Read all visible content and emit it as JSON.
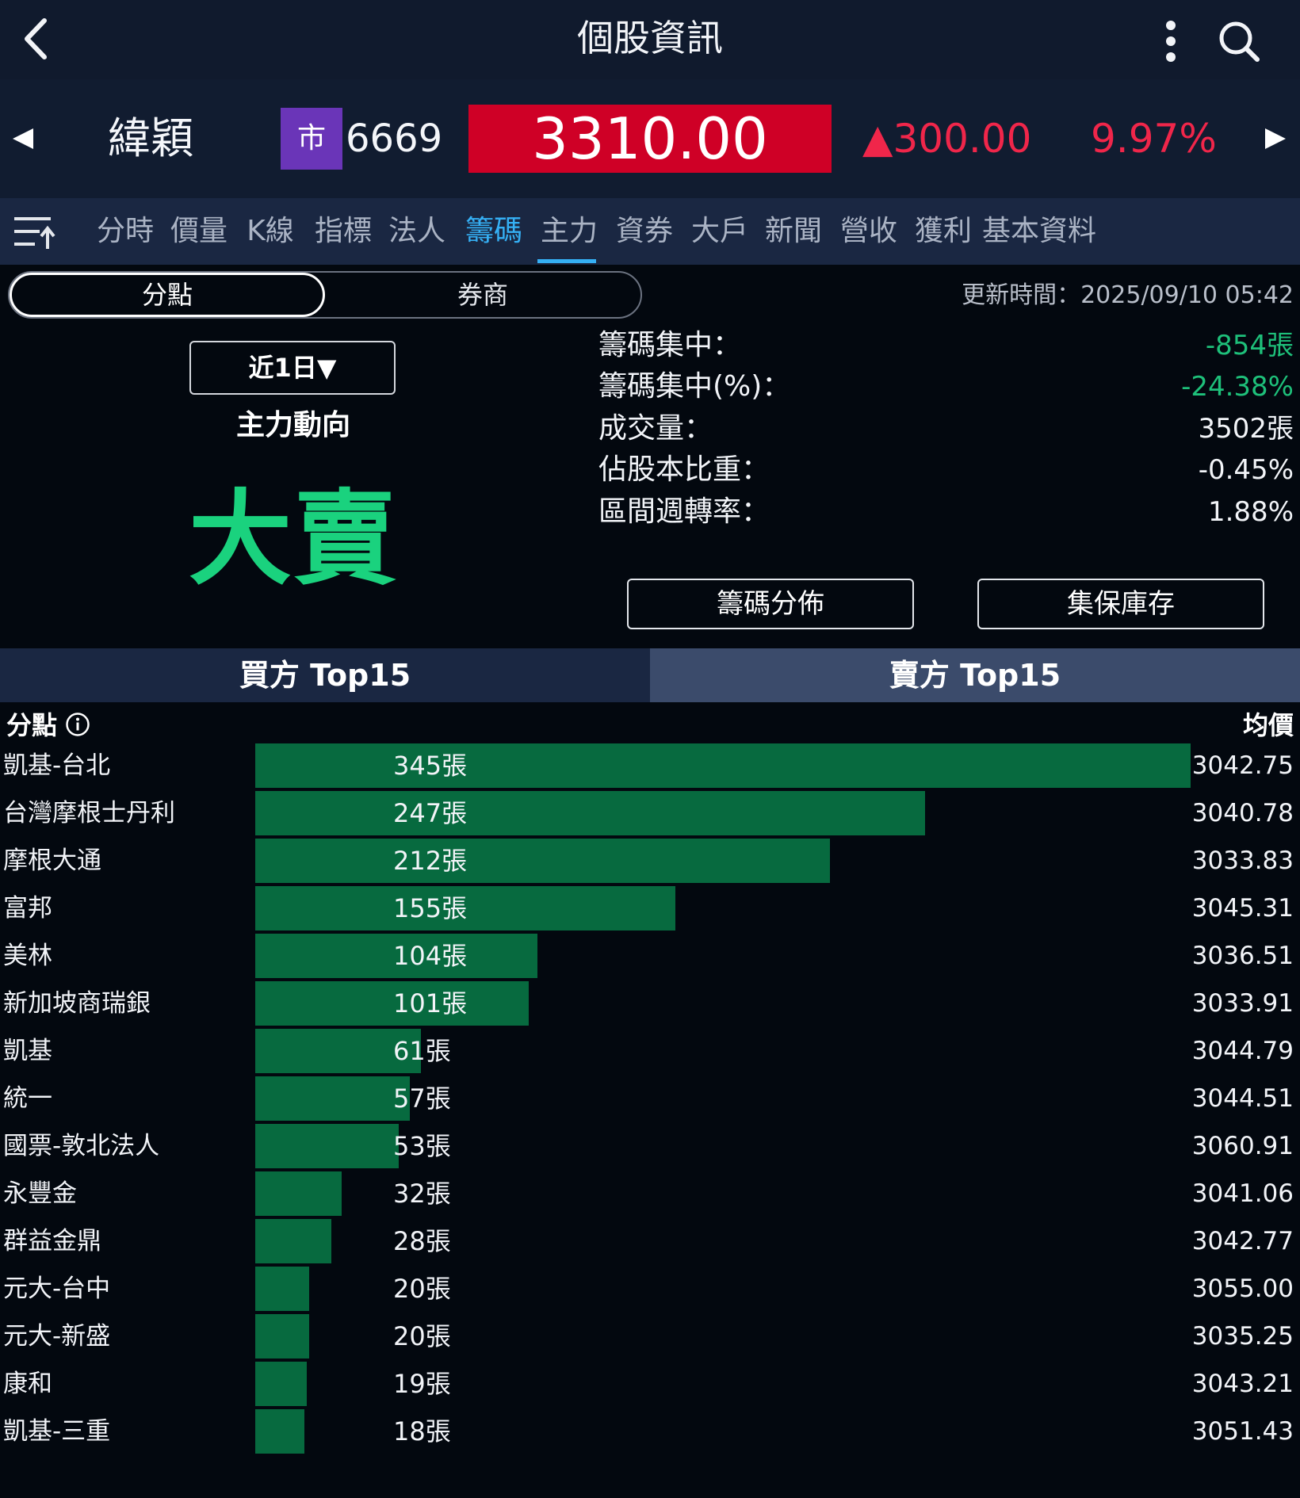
{
  "header": {
    "title": "個股資訊"
  },
  "quote": {
    "stock_name": "緯穎",
    "market_badge": "市",
    "stock_code": "6669",
    "price": "3310.00",
    "change": "▲300.00",
    "change_pct": "9.97%"
  },
  "tabs": [
    {
      "label": "分時",
      "active": false
    },
    {
      "label": "價量",
      "active": false
    },
    {
      "label": "K線",
      "active": false
    },
    {
      "label": "指標",
      "active": false
    },
    {
      "label": "法人",
      "active": false
    },
    {
      "label": "籌碼",
      "active": true
    },
    {
      "label": "主力",
      "active": false
    },
    {
      "label": "資券",
      "active": false
    },
    {
      "label": "大戶",
      "active": false
    },
    {
      "label": "新聞",
      "active": false
    },
    {
      "label": "營收",
      "active": false
    },
    {
      "label": "獲利",
      "active": false
    },
    {
      "label": "基本資料",
      "active": false
    }
  ],
  "segment": {
    "branch": "分點",
    "broker": "券商",
    "selected": "分點"
  },
  "update_time": "更新時間：2025/09/10 05:42",
  "summary": {
    "period": "近1日▼",
    "trend_label": "主力動向",
    "trend_value": "大賣"
  },
  "stats": [
    {
      "label": "籌碼集中：",
      "value": "-854張",
      "color": "#1ec07a"
    },
    {
      "label": "籌碼集中(%)：",
      "value": "-24.38%",
      "color": "#1ec07a"
    },
    {
      "label": "成交量：",
      "value": "3502張",
      "color": "#f2f4f8"
    },
    {
      "label": "佔股本比重：",
      "value": "-0.45%",
      "color": "#f2f4f8"
    },
    {
      "label": "區間週轉率：",
      "value": "1.88%",
      "color": "#f2f4f8"
    }
  ],
  "buttons": {
    "distribution": "籌碼分佈",
    "custody": "集保庫存"
  },
  "side_tabs": {
    "buy": "買方 Top15",
    "sell": "賣方 Top15",
    "selected": "buy"
  },
  "list": {
    "col_branch": "分點",
    "col_avg": "均價",
    "bar_color": "#076a3f",
    "max_volume": 345,
    "rows": [
      {
        "name": "凱基-台北",
        "volume": 345,
        "volume_label": "345張",
        "avg": "3042.75"
      },
      {
        "name": "台灣摩根士丹利",
        "volume": 247,
        "volume_label": "247張",
        "avg": "3040.78"
      },
      {
        "name": "摩根大通",
        "volume": 212,
        "volume_label": "212張",
        "avg": "3033.83"
      },
      {
        "name": "富邦",
        "volume": 155,
        "volume_label": "155張",
        "avg": "3045.31"
      },
      {
        "name": "美林",
        "volume": 104,
        "volume_label": "104張",
        "avg": "3036.51"
      },
      {
        "name": "新加坡商瑞銀",
        "volume": 101,
        "volume_label": "101張",
        "avg": "3033.91"
      },
      {
        "name": "凱基",
        "volume": 61,
        "volume_label": "61張",
        "avg": "3044.79"
      },
      {
        "name": "統一",
        "volume": 57,
        "volume_label": "57張",
        "avg": "3044.51"
      },
      {
        "name": "國票-敦北法人",
        "volume": 53,
        "volume_label": "53張",
        "avg": "3060.91"
      },
      {
        "name": "永豐金",
        "volume": 32,
        "volume_label": "32張",
        "avg": "3041.06"
      },
      {
        "name": "群益金鼎",
        "volume": 28,
        "volume_label": "28張",
        "avg": "3042.77"
      },
      {
        "name": "元大-台中",
        "volume": 20,
        "volume_label": "20張",
        "avg": "3055.00"
      },
      {
        "name": "元大-新盛",
        "volume": 20,
        "volume_label": "20張",
        "avg": "3035.25"
      },
      {
        "name": "康和",
        "volume": 19,
        "volume_label": "19張",
        "avg": "3043.21"
      },
      {
        "name": "凱基-三重",
        "volume": 18,
        "volume_label": "18張",
        "avg": "3051.43"
      }
    ]
  },
  "icons": {
    "back": "chevron-left-icon",
    "more": "more-vertical-icon",
    "search": "search-icon",
    "prev": "triangle-left-icon",
    "next": "triangle-right-icon",
    "menu": "sort-menu-icon",
    "info": "info-icon"
  },
  "colors": {
    "up": "#f0264a",
    "price_bg": "#cf0026",
    "accent": "#35b0f5",
    "sell_green": "#1ad27e",
    "badge": "#6a35b8"
  }
}
